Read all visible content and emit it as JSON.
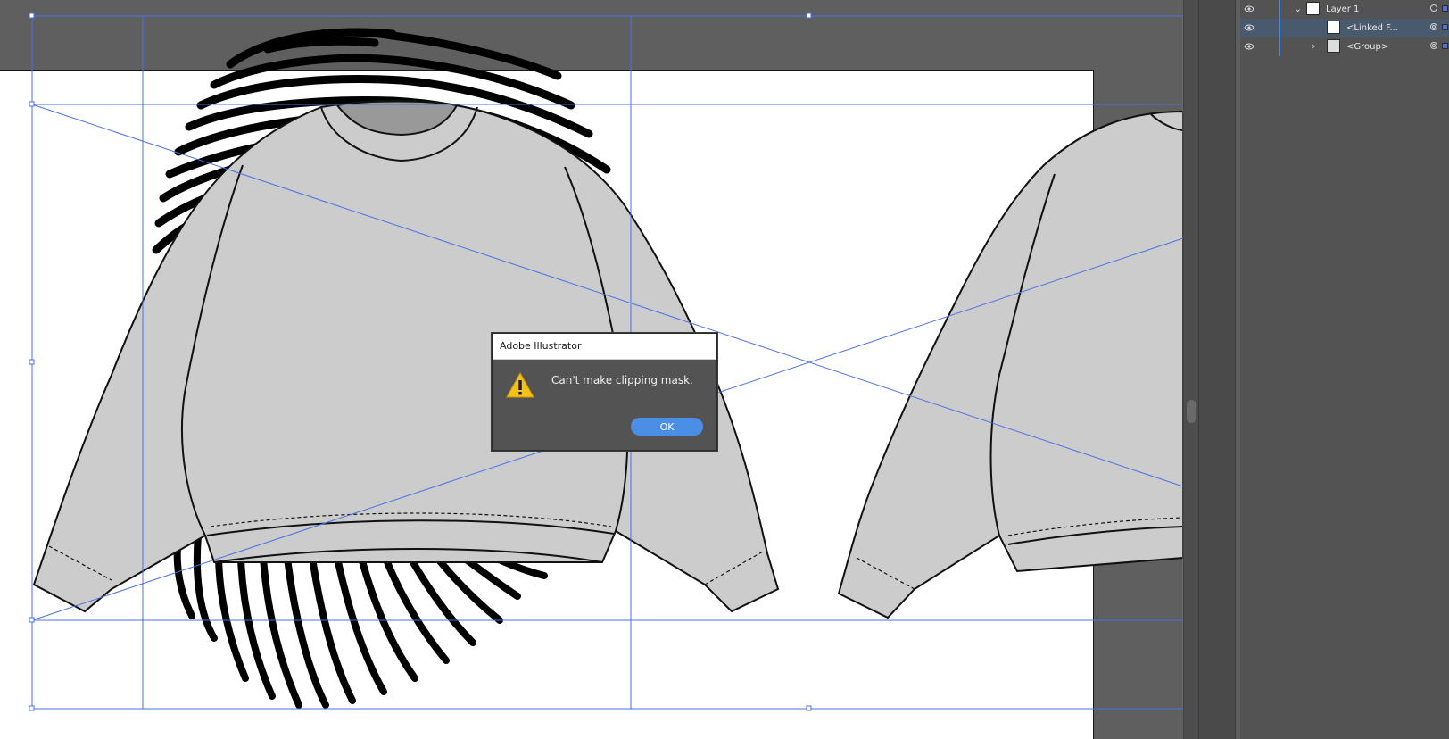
{
  "dialog": {
    "title": "Adobe Illustrator",
    "message": "Can't make clipping mask.",
    "ok_label": "OK",
    "icon": "warning-icon"
  },
  "layers_panel": {
    "rows": [
      {
        "label": "Layer 1",
        "expanded": true,
        "selected": false,
        "icon": "layer-thumbnail"
      },
      {
        "label": "<Linked F...",
        "expanded": false,
        "selected": true,
        "icon": "linked-file-thumbnail"
      },
      {
        "label": "<Group>",
        "expanded": false,
        "selected": false,
        "icon": "group-thumbnail"
      }
    ]
  },
  "colors": {
    "selection_blue": "#4b6fe8",
    "canvas_bg": "#5f5f5f",
    "panel_bg": "#535353",
    "ok_button": "#4b8ee6",
    "sweater_fill": "#cccccc"
  }
}
